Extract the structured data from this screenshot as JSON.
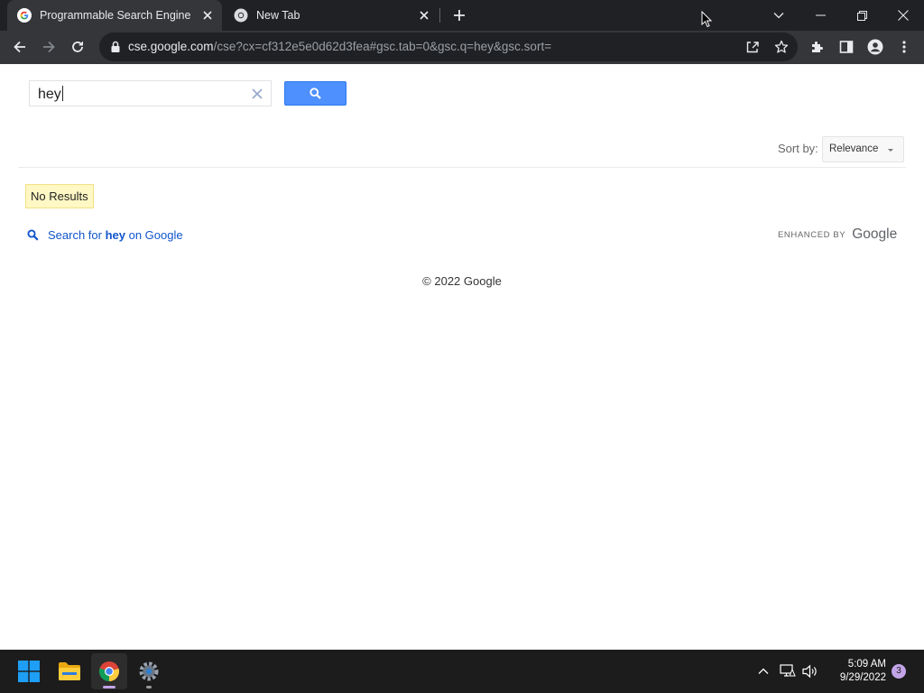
{
  "browser": {
    "tabs": [
      {
        "title": "Programmable Search Engine",
        "icon": "google-g-icon",
        "active": true
      },
      {
        "title": "New Tab",
        "icon": "chrome-icon",
        "active": false
      }
    ],
    "url_host": "cse.google.com",
    "url_rest": "/cse?cx=cf312e5e0d62d3fea#gsc.tab=0&gsc.q=hey&gsc.sort="
  },
  "search": {
    "query": "hey",
    "clear_icon": "close-icon",
    "button_icon": "search-icon"
  },
  "sort": {
    "label": "Sort by:",
    "selected": "Relevance"
  },
  "results": {
    "no_results": "No Results",
    "google_prefix": "Search for ",
    "google_term": "hey",
    "google_suffix": " on Google"
  },
  "branding": {
    "enhanced_by": "ENHANCED BY",
    "logo": "Google"
  },
  "footer": {
    "copyright": "© 2022 Google"
  },
  "taskbar": {
    "time": "5:09 AM",
    "date": "9/29/2022",
    "notification_count": "3"
  },
  "colors": {
    "accent": "#4d90fe",
    "link": "#1155cc",
    "no_results_bg": "#fff8c4"
  }
}
